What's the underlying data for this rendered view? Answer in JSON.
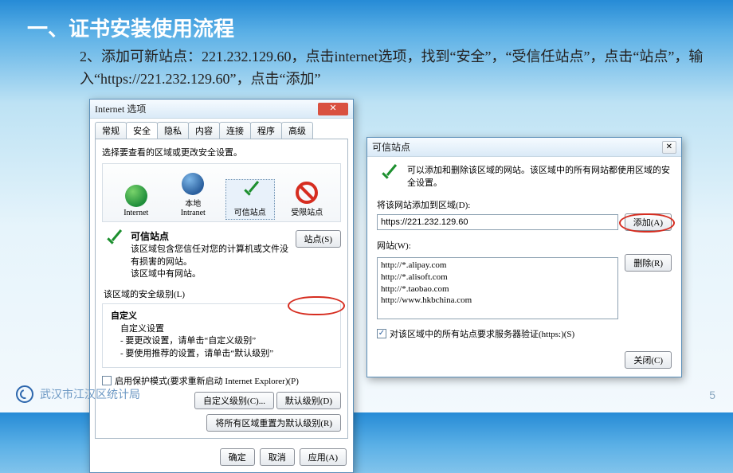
{
  "slide": {
    "heading": "一、证书安装使用流程",
    "subtitle": "2、添加可新站点：221.232.129.60，点击internet选项，找到“安全”，“受信任站点”，点击“站点”，输入“https://221.232.129.60”，点击“添加”",
    "footer": "武汉市江汉区统计局",
    "page": "5"
  },
  "internet_options": {
    "title": "Internet 选项",
    "close": "✕",
    "tabs": [
      "常规",
      "安全",
      "隐私",
      "内容",
      "连接",
      "程序",
      "高级"
    ],
    "active_tab": "安全",
    "prompt": "选择要查看的区域或更改安全设置。",
    "zones": {
      "internet": "Internet",
      "local": "本地\nIntranet",
      "trusted": "可信站点",
      "restricted": "受限站点"
    },
    "selected_zone_title": "可信站点",
    "selected_zone_desc1": "该区域包含您信任对您的计算机或文件没有损害的网站。",
    "selected_zone_desc2": "该区域中有网站。",
    "sites_button": "站点(S)",
    "level_label": "该区域的安全级别(L)",
    "custom_title": "自定义",
    "custom_line1": "自定义设置",
    "custom_line2": "- 要更改设置，请单击“自定义级别”",
    "custom_line3": "- 要使用推荐的设置，请单击“默认级别”",
    "protected_mode": "启用保护模式(要求重新启动 Internet Explorer)(P)",
    "btn_custom_level": "自定义级别(C)...",
    "btn_default_level": "默认级别(D)",
    "btn_reset_all": "将所有区域重置为默认级别(R)",
    "btn_ok": "确定",
    "btn_cancel": "取消",
    "btn_apply": "应用(A)"
  },
  "trusted_sites": {
    "title": "可信站点",
    "close_icon": "✕",
    "intro": "可以添加和删除该区域的网站。该区域中的所有网站都使用区域的安全设置。",
    "add_label": "将该网站添加到区域(D):",
    "input_value": "https://221.232.129.60",
    "btn_add": "添加(A)",
    "list_label": "网站(W):",
    "sites": [
      "http://*.alipay.com",
      "http://*.alisoft.com",
      "http://*.taobao.com",
      "http://www.hkbchina.com"
    ],
    "btn_remove": "删除(R)",
    "require_https": "对该区域中的所有站点要求服务器验证(https:)(S)",
    "btn_close": "关闭(C)"
  }
}
